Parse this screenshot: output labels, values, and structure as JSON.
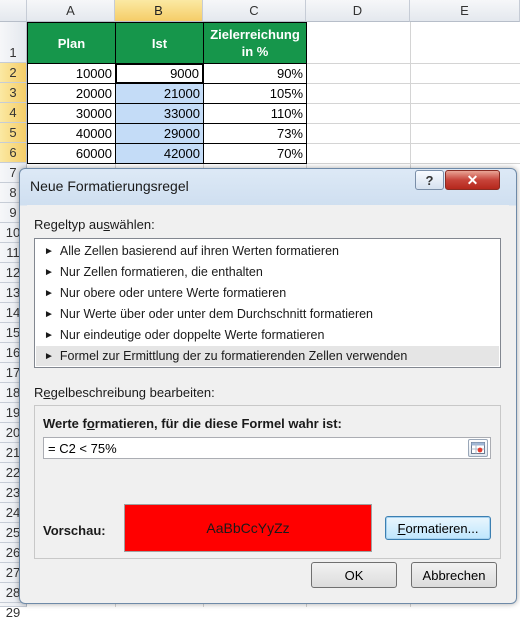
{
  "spreadsheet": {
    "columns": [
      "A",
      "B",
      "C",
      "D",
      "E"
    ],
    "rows": [
      "1",
      "2",
      "3",
      "4",
      "5",
      "6",
      "7",
      "8",
      "9",
      "10",
      "11",
      "12",
      "13",
      "14",
      "15",
      "16",
      "17",
      "18",
      "19",
      "20",
      "21",
      "22",
      "23",
      "24",
      "25",
      "26",
      "27",
      "28",
      "29"
    ],
    "headers": {
      "plan": "Plan",
      "ist": "Ist",
      "ziel_line1": "Zielerreichung",
      "ziel_line2": "in %"
    },
    "data": [
      [
        "10000",
        "9000",
        "90%"
      ],
      [
        "20000",
        "21000",
        "105%"
      ],
      [
        "30000",
        "33000",
        "110%"
      ],
      [
        "40000",
        "29000",
        "73%"
      ],
      [
        "60000",
        "42000",
        "70%"
      ]
    ],
    "header_color": "#16964b",
    "selection_color": "#c4dcf7"
  },
  "dialog": {
    "title": "Neue Formatierungsregel",
    "help_glyph": "?",
    "close_glyph": "✕",
    "regeltyp_label_pre": "Regeltyp au",
    "regeltyp_label_u": "s",
    "regeltyp_label_post": "wählen:",
    "rule_types": [
      "Alle Zellen basierend auf ihren Werten formatieren",
      "Nur Zellen formatieren, die enthalten",
      "Nur obere oder untere Werte formatieren",
      "Nur Werte über oder unter dem Durchschnitt formatieren",
      "Nur eindeutige oder doppelte Werte formatieren",
      "Formel zur Ermittlung der zu formatierenden Zellen verwenden"
    ],
    "arrow_glyph": "►",
    "selected_index": 5,
    "regelbeschreibung_label_pre": "R",
    "regelbeschreibung_label_u": "e",
    "regelbeschreibung_label_post": "gelbeschreibung bearbeiten:",
    "formula_heading_pre": "Werte f",
    "formula_heading_u": "o",
    "formula_heading_post": "rmatieren, für die diese Formel wahr ist:",
    "formula_value": "= C2 < 75%",
    "preview_label": "Vorschau:",
    "preview_text": "AaBbCcYyZz",
    "preview_color": "#ff0000",
    "format_button_u": "F",
    "format_button_post": "ormatieren...",
    "ok_button": "OK",
    "cancel_button": "Abbrechen"
  }
}
